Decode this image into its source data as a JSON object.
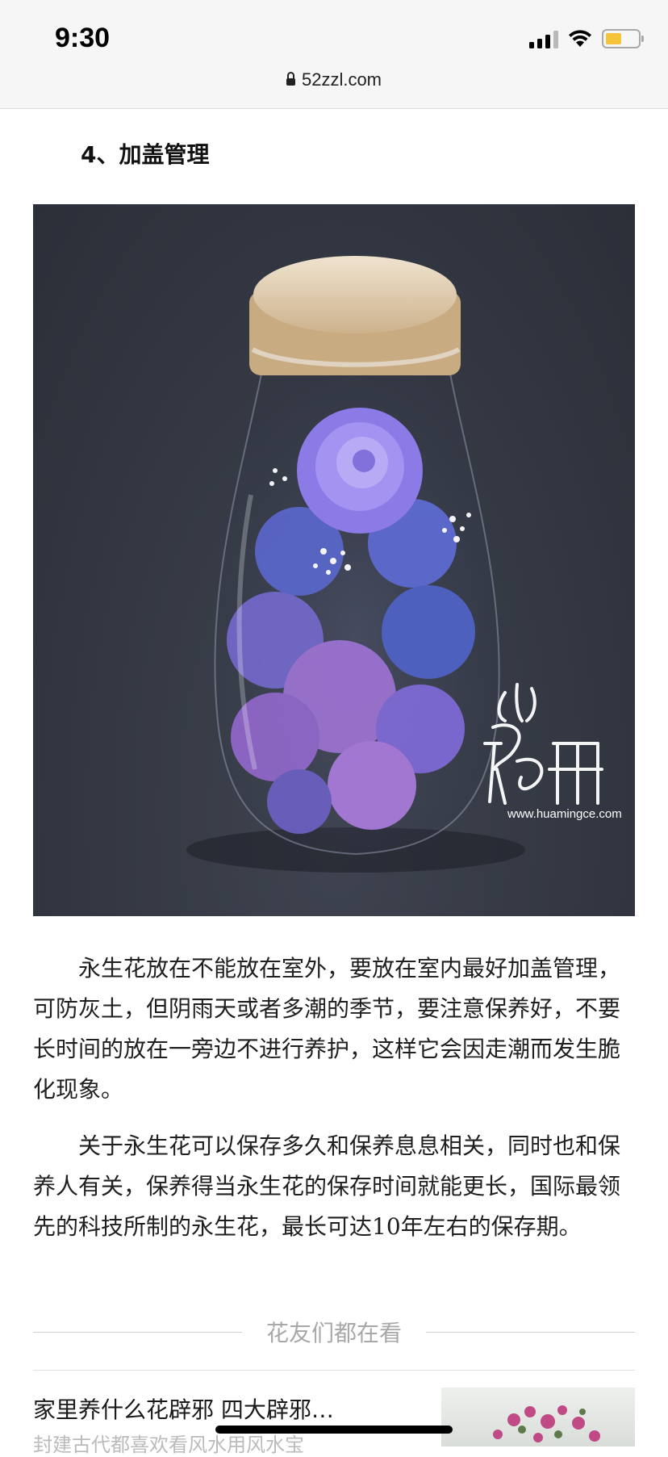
{
  "status_bar": {
    "time": "9:30"
  },
  "browser": {
    "url": "52zzl.com"
  },
  "article": {
    "heading": "4、加盖管理",
    "photo_watermark": "www.huamingce.com",
    "paragraphs": [
      "永生花放在不能放在室外，要放在室内最好加盖管理，可防灰土，但阴雨天或者多潮的季节，要注意保养好，不要长时间的放在一旁边不进行养护，这样它会因走潮而发生脆化现象。",
      "关于永生花可以保存多久和保养息息相关，同时也和保养人有关，保养得当永生花的保存时间就能更长，国际最领先的科技所制的永生花，最长可达10年左右的保存期。"
    ]
  },
  "related": {
    "section_title": "花友们都在看",
    "items": [
      {
        "title": "家里养什么花辟邪 四大辟邪…",
        "subtitle": "封建古代都喜欢看风水用风水宝"
      }
    ]
  },
  "colors": {
    "battery": "#f5c43a",
    "photo_bg": "#363b46"
  }
}
